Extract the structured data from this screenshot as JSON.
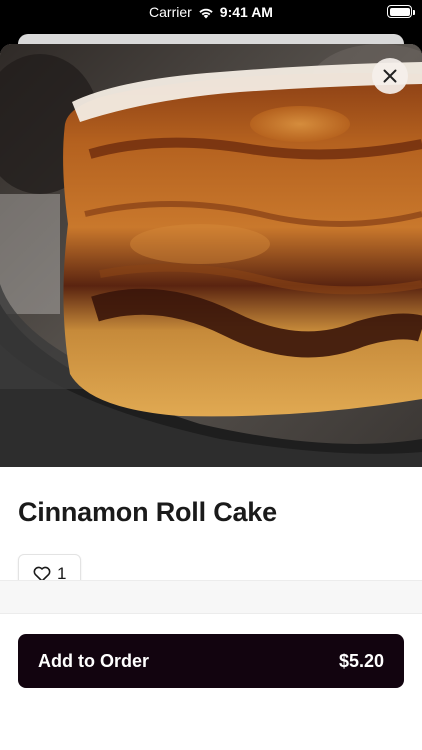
{
  "status_bar": {
    "carrier": "Carrier",
    "time": "9:41 AM",
    "wifi_icon": "wifi-icon",
    "battery_icon": "battery-icon"
  },
  "product": {
    "title": "Cinnamon Roll Cake",
    "image_icon": "cake-photo",
    "likes": "1"
  },
  "close_icon": "close-icon",
  "like_icon": "heart-icon",
  "order_button": {
    "label": "Add to Order",
    "price": "$5.20",
    "background": "#12040f"
  }
}
